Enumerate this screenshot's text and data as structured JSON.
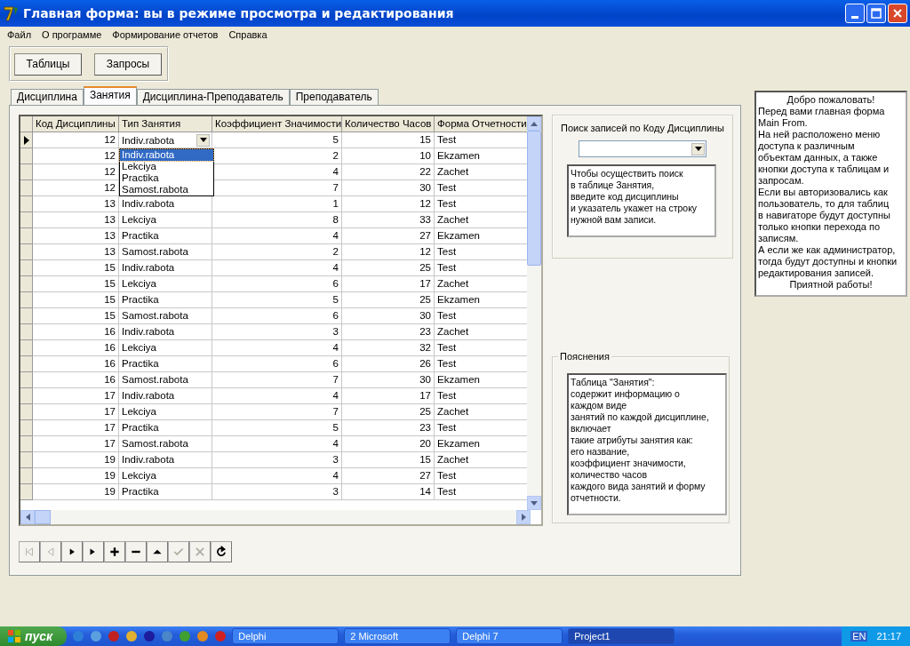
{
  "window": {
    "title": "Главная форма: вы в режиме просмотра и редактирования"
  },
  "menu": [
    "Файл",
    "О программе",
    "Формирование отчетов",
    "Справка"
  ],
  "toolbar_buttons": [
    "Таблицы",
    "Запросы"
  ],
  "tabs": [
    {
      "label": "Дисциплина",
      "selected": false
    },
    {
      "label": "Занятия",
      "selected": true
    },
    {
      "label": "Дисциплина-Преподаватель",
      "selected": false
    },
    {
      "label": "Преподаватель",
      "selected": false
    }
  ],
  "grid": {
    "columns": [
      {
        "label": "Код Дисциплины",
        "kind": "number"
      },
      {
        "label": "Тип Занятия",
        "kind": "text"
      },
      {
        "label": "Коэффициент Значимости",
        "kind": "number"
      },
      {
        "label": "Количество Часов",
        "kind": "number"
      },
      {
        "label": "Форма Отчетности",
        "kind": "text"
      }
    ],
    "rows": [
      {
        "selected": true,
        "cells": [
          "12",
          "Indiv.rabota",
          "5",
          "15",
          "Test"
        ]
      },
      {
        "selected": false,
        "cells": [
          "12",
          "",
          "2",
          "10",
          "Ekzamen"
        ]
      },
      {
        "selected": false,
        "cells": [
          "12",
          "",
          "4",
          "22",
          "Zachet"
        ]
      },
      {
        "selected": false,
        "cells": [
          "12",
          "",
          "7",
          "30",
          "Test"
        ]
      },
      {
        "selected": false,
        "cells": [
          "13",
          "Indiv.rabota",
          "1",
          "12",
          "Test"
        ]
      },
      {
        "selected": false,
        "cells": [
          "13",
          "Lekciya",
          "8",
          "33",
          "Zachet"
        ]
      },
      {
        "selected": false,
        "cells": [
          "13",
          "Practika",
          "4",
          "27",
          "Ekzamen"
        ]
      },
      {
        "selected": false,
        "cells": [
          "13",
          "Samost.rabota",
          "2",
          "12",
          "Test"
        ]
      },
      {
        "selected": false,
        "cells": [
          "15",
          "Indiv.rabota",
          "4",
          "25",
          "Test"
        ]
      },
      {
        "selected": false,
        "cells": [
          "15",
          "Lekciya",
          "6",
          "17",
          "Zachet"
        ]
      },
      {
        "selected": false,
        "cells": [
          "15",
          "Practika",
          "5",
          "25",
          "Ekzamen"
        ]
      },
      {
        "selected": false,
        "cells": [
          "15",
          "Samost.rabota",
          "6",
          "30",
          "Test"
        ]
      },
      {
        "selected": false,
        "cells": [
          "16",
          "Indiv.rabota",
          "3",
          "23",
          "Zachet"
        ]
      },
      {
        "selected": false,
        "cells": [
          "16",
          "Lekciya",
          "4",
          "32",
          "Test"
        ]
      },
      {
        "selected": false,
        "cells": [
          "16",
          "Practika",
          "6",
          "26",
          "Test"
        ]
      },
      {
        "selected": false,
        "cells": [
          "16",
          "Samost.rabota",
          "7",
          "30",
          "Ekzamen"
        ]
      },
      {
        "selected": false,
        "cells": [
          "17",
          "Indiv.rabota",
          "4",
          "17",
          "Test"
        ]
      },
      {
        "selected": false,
        "cells": [
          "17",
          "Lekciya",
          "7",
          "25",
          "Zachet"
        ]
      },
      {
        "selected": false,
        "cells": [
          "17",
          "Practika",
          "5",
          "23",
          "Test"
        ]
      },
      {
        "selected": false,
        "cells": [
          "17",
          "Samost.rabota",
          "4",
          "20",
          "Ekzamen"
        ]
      },
      {
        "selected": false,
        "cells": [
          "19",
          "Indiv.rabota",
          "3",
          "15",
          "Zachet"
        ]
      },
      {
        "selected": false,
        "cells": [
          "19",
          "Lekciya",
          "4",
          "27",
          "Test"
        ]
      },
      {
        "selected": false,
        "cells": [
          "19",
          "Practika",
          "3",
          "14",
          "Test"
        ]
      }
    ],
    "dropdown": {
      "options": [
        {
          "label": "Indiv.rabota",
          "selected": true
        },
        {
          "label": "Lekciya",
          "selected": false
        },
        {
          "label": "Practika",
          "selected": false
        },
        {
          "label": "Samost.rabota",
          "selected": false
        }
      ]
    }
  },
  "navigator": [
    {
      "kind": "first",
      "disabled": true
    },
    {
      "kind": "prior",
      "disabled": true
    },
    {
      "kind": "next",
      "disabled": false
    },
    {
      "kind": "last",
      "disabled": false
    },
    {
      "kind": "insert",
      "disabled": false
    },
    {
      "kind": "delete",
      "disabled": false
    },
    {
      "kind": "edit",
      "disabled": false
    },
    {
      "kind": "post",
      "disabled": true
    },
    {
      "kind": "cancel",
      "disabled": true
    },
    {
      "kind": "refresh",
      "disabled": false
    }
  ],
  "search": {
    "title": "Поиск записей по Коду Дисциплины",
    "hint": "Чтобы осуществить поиск\nв таблице Занятия,\nвведите код дисциплины\nи указатель укажет на строку\nнужной вам записи."
  },
  "explanation": {
    "title": "Пояснения",
    "text": "Таблица \"Занятия\":\nсодержит информацию о\nкаждом виде\nзанятий по каждой дисциплине,\nвключает\nтакие атрибуты занятия как:\nего название,\nкоэффициент значимости,\nколичество часов\nкаждого вида занятий и форму\nотчетности."
  },
  "welcome": [
    {
      "kind": "greeting",
      "text": "Добро пожаловать!"
    },
    {
      "kind": "body",
      "text": "Перед вами главная форма\nMain From.\nНа ней расположено меню\nдоступа к различным\nобъектам данных, а также\nкнопки доступа к таблицам и\nзапросам.\nЕсли вы авторизовались как\nпользователь, то для таблиц\nв навигаторе будут доступны\nтолько кнопки перехода по\nзаписям.\nА если же как администратор,\nтогда будут доступны и кнопки\nредактирования записей."
    },
    {
      "kind": "greeting",
      "text": "Приятной работы!"
    }
  ],
  "taskbar": {
    "start": "пуск",
    "tasks": [
      {
        "label": "Delphi",
        "selected": false
      },
      {
        "label": "2 Microsoft",
        "selected": false
      },
      {
        "label": "Delphi 7",
        "selected": false
      },
      {
        "label": "Project1",
        "selected": true
      }
    ],
    "language": "EN",
    "clock": "21:17"
  }
}
